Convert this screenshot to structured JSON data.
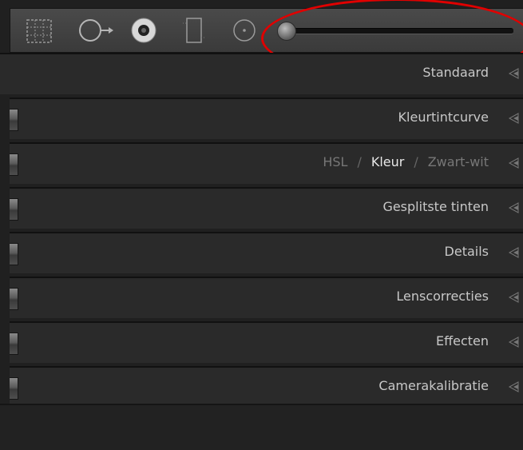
{
  "toolbar": {
    "tools": [
      "grid-overlay-icon",
      "crop-overlay-icon",
      "spot-removal-icon",
      "graduated-filter-icon",
      "radial-filter-icon"
    ],
    "slider": {
      "value": 0.0
    },
    "highlight_color": "#e00000"
  },
  "panels": {
    "standaard": "Standaard",
    "kleurtintcurve": "Kleurtintcurve",
    "hsl": "HSL",
    "kleur": "Kleur",
    "zwartwit": "Zwart-wit",
    "separator": "/",
    "gesplitste": "Gesplitste tinten",
    "details": "Details",
    "lens": "Lenscorrecties",
    "effecten": "Effecten",
    "camera": "Camerakalibratie"
  }
}
